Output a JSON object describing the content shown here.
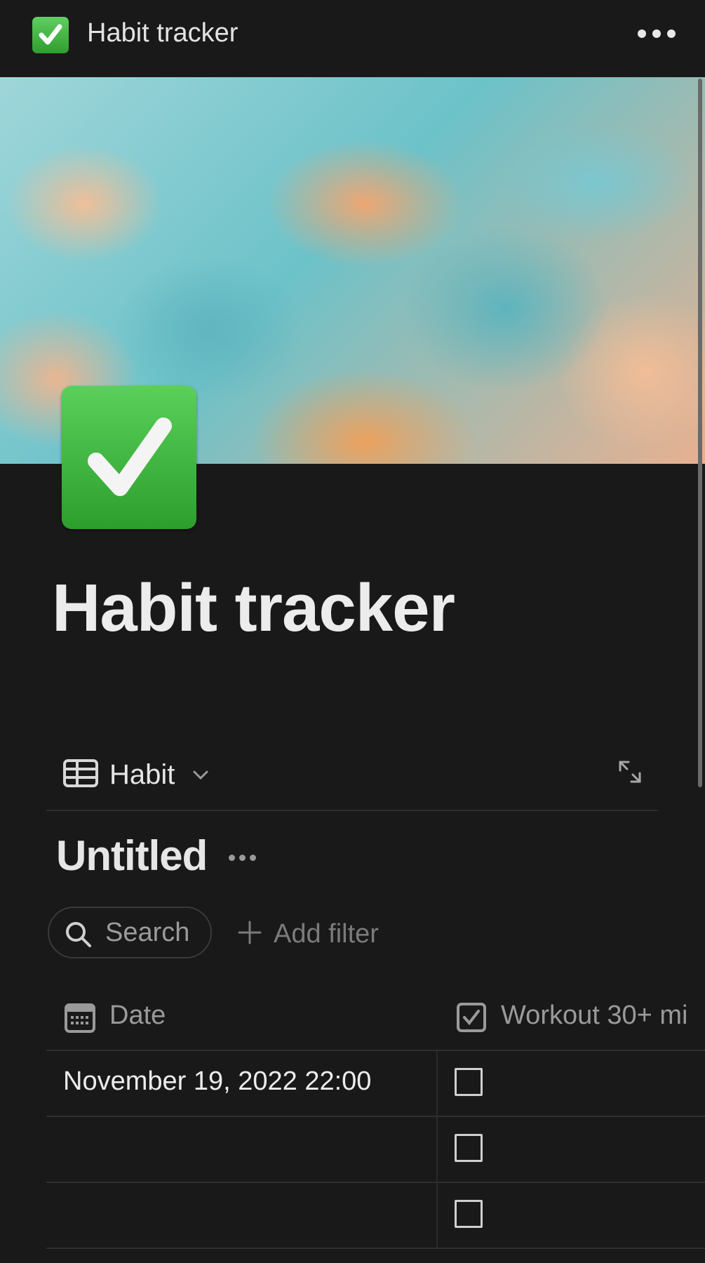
{
  "topbar": {
    "title": "Habit tracker",
    "more_icon": "ellipsis-icon"
  },
  "page": {
    "title": "Habit tracker",
    "icon": "check-mark-button-emoji"
  },
  "view": {
    "label": "Habit",
    "icon": "table-icon"
  },
  "database": {
    "title": "Untitled"
  },
  "toolbar": {
    "search_label": "Search",
    "add_filter_label": "Add filter"
  },
  "table": {
    "columns": [
      {
        "label": "Date",
        "icon": "calendar-icon"
      },
      {
        "label": "Workout 30+ mi",
        "icon": "checkbox-icon"
      }
    ],
    "rows": [
      {
        "date": "November 19, 2022 22:00",
        "checked": false
      },
      {
        "date": "",
        "checked": false
      },
      {
        "date": "",
        "checked": false
      }
    ]
  },
  "colors": {
    "background": "#191919",
    "accent_green": "#2f9d2f"
  }
}
